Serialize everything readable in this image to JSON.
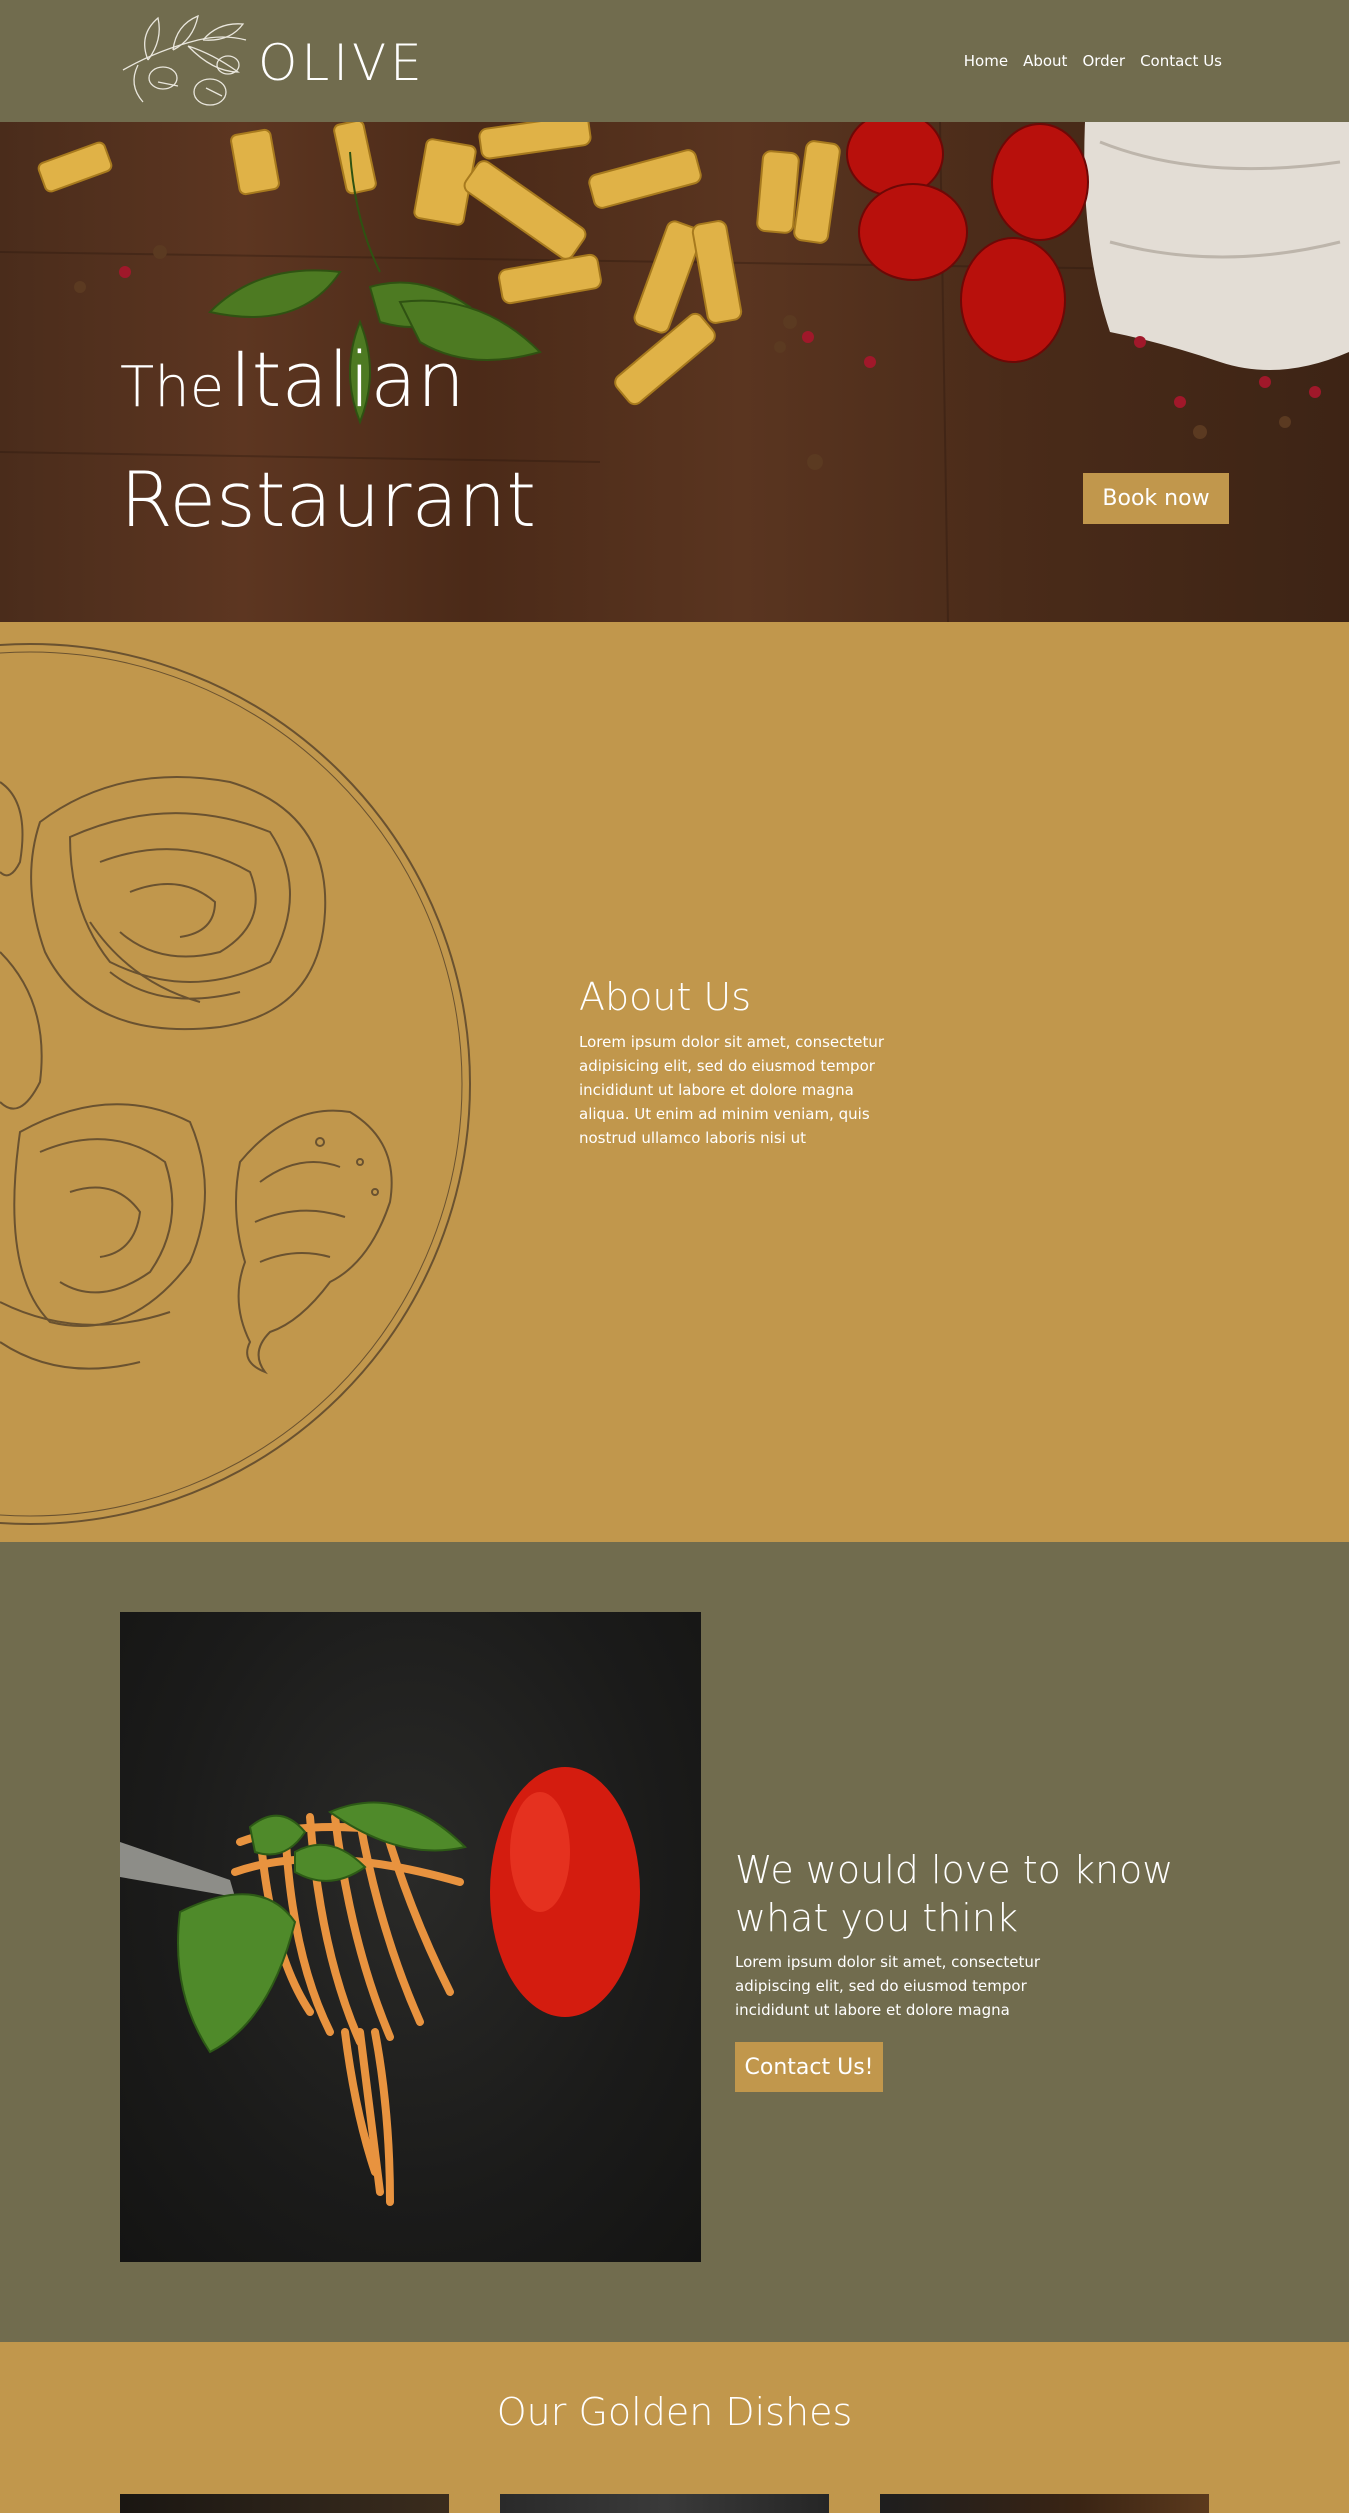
{
  "header": {
    "logo_text": "OLIVE",
    "nav": [
      "Home",
      "About",
      "Order",
      "Contact Us"
    ]
  },
  "hero": {
    "title_small": "The",
    "title_big": "Italian",
    "title_line2": "Restaurant",
    "cta_label": "Book now"
  },
  "about": {
    "title": "About Us",
    "text": "Lorem ipsum dolor sit amet, consectetur adipisicing elit, sed do eiusmod tempor incididunt ut labore et dolore magna aliqua. Ut enim ad minim veniam, quis nostrud ullamco laboris nisi ut"
  },
  "feedback": {
    "title": "We would love to know what you think",
    "text": "Lorem ipsum dolor sit amet, consectetur adipiscing elit, sed do eiusmod tempor incididunt ut labore et dolore magna",
    "cta_label": "Contact Us!"
  },
  "dishes": {
    "title": "Our Golden Dishes"
  },
  "colors": {
    "olive": "#716c4e",
    "gold": "#c1974c",
    "text": "#ffffff"
  }
}
